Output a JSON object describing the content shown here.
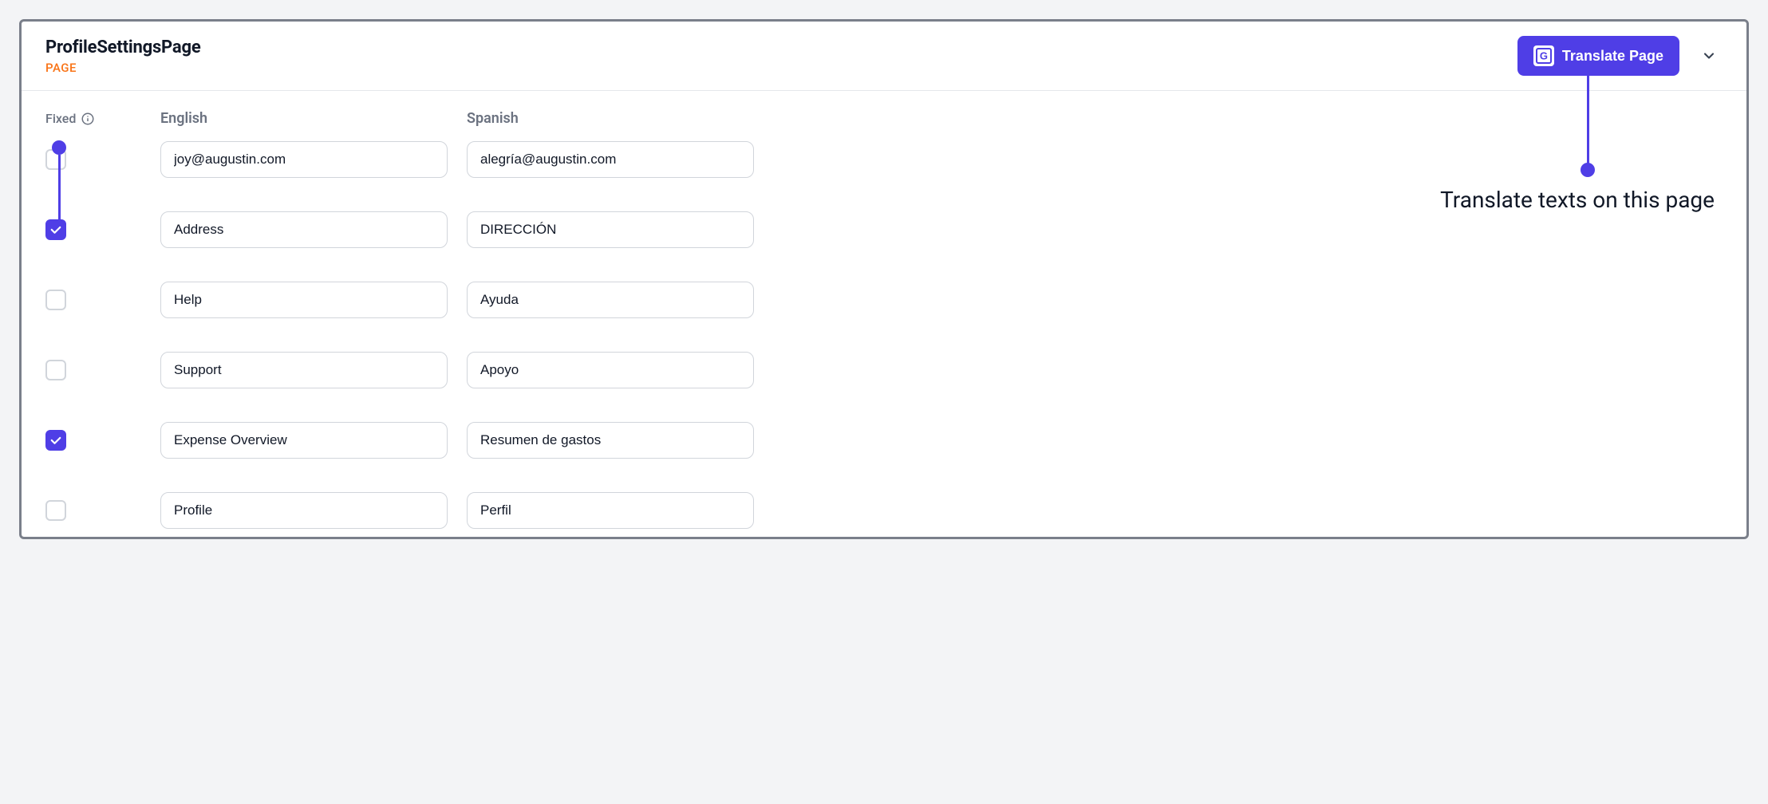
{
  "header": {
    "title": "ProfileSettingsPage",
    "subtitle": "PAGE",
    "translate_label": "Translate Page"
  },
  "columns": {
    "fixed": "Fixed",
    "source_lang": "English",
    "target_lang": "Spanish"
  },
  "rows": [
    {
      "fixed": false,
      "source": "joy@augustin.com",
      "target": "alegría@augustin.com"
    },
    {
      "fixed": true,
      "source": "Address",
      "target": "DIRECCIÓN"
    },
    {
      "fixed": false,
      "source": "Help",
      "target": "Ayuda"
    },
    {
      "fixed": false,
      "source": "Support",
      "target": "Apoyo"
    },
    {
      "fixed": true,
      "source": "Expense Overview",
      "target": "Resumen de gastos"
    },
    {
      "fixed": false,
      "source": "Profile",
      "target": "Perfil"
    }
  ],
  "callouts": {
    "translate": "Translate texts on this page"
  },
  "colors": {
    "accent": "#4f3ee6",
    "subtitle": "#f97316"
  }
}
